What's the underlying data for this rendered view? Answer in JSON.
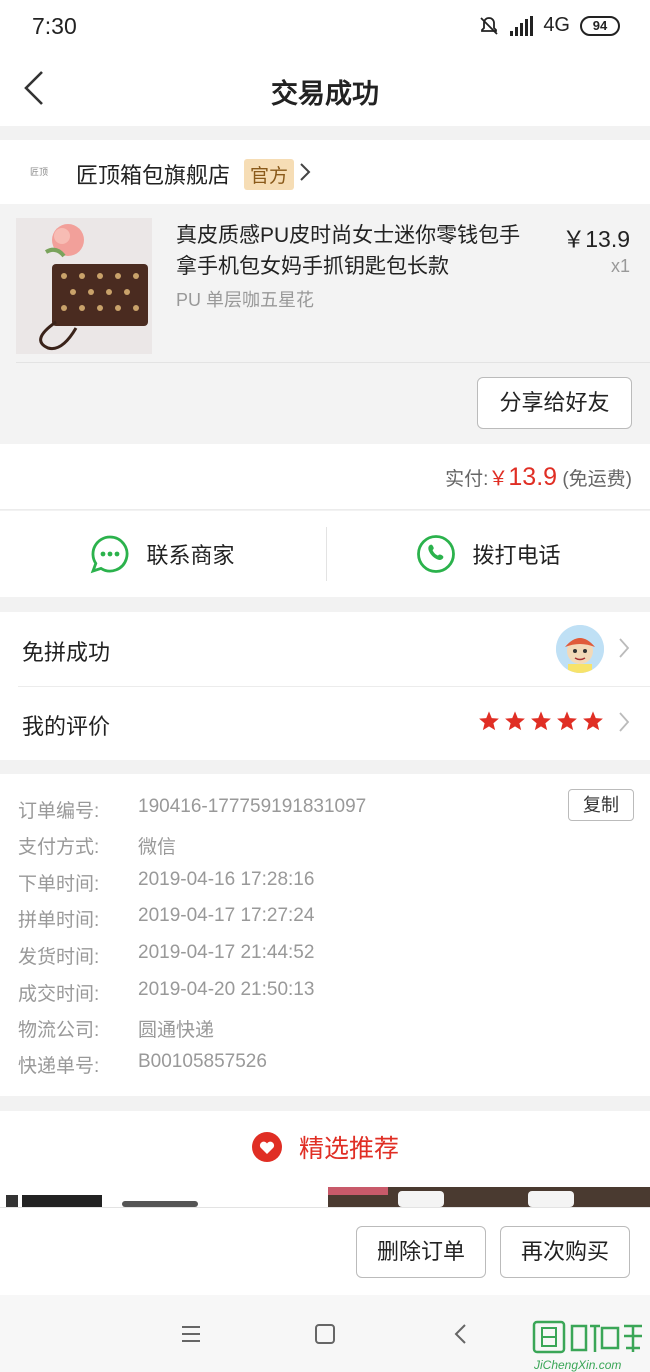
{
  "status_bar": {
    "time": "7:30",
    "network": "4G",
    "battery": "94"
  },
  "nav": {
    "title": "交易成功"
  },
  "shop": {
    "logo_text": "匠顶",
    "name": "匠顶箱包旗舰店",
    "badge": "官方"
  },
  "product": {
    "title": "真皮质感PU皮时尚女士迷你零钱包手拿手机包女妈手抓钥匙包长款",
    "spec": "PU 单层咖五星花",
    "price": "￥13.9",
    "qty": "x1",
    "share_label": "分享给好友"
  },
  "payment": {
    "label": "实付:",
    "currency": "￥",
    "amount": "13.9",
    "note": "(免运费)"
  },
  "contact": {
    "merchant_label": "联系商家",
    "call_label": "拨打电话"
  },
  "rows": {
    "group_label": "免拼成功",
    "review_label": "我的评价",
    "review_stars": 5
  },
  "order_info": {
    "copy_label": "复制",
    "lines": [
      {
        "k": "订单编号:",
        "v": "190416-177759191831097"
      },
      {
        "k": "支付方式:",
        "v": "微信"
      },
      {
        "k": "下单时间:",
        "v": "2019-04-16 17:28:16"
      },
      {
        "k": "拼单时间:",
        "v": "2019-04-17 17:27:24"
      },
      {
        "k": "发货时间:",
        "v": "2019-04-17 21:44:52"
      },
      {
        "k": "成交时间:",
        "v": "2019-04-20 21:50:13"
      },
      {
        "k": "物流公司:",
        "v": "圆通快递"
      },
      {
        "k": "快递单号:",
        "v": "B00105857526"
      }
    ]
  },
  "recommend": {
    "title": "精选推荐"
  },
  "bottom": {
    "delete_label": "删除订单",
    "rebuy_label": "再次购买"
  },
  "watermark": {
    "text": "集诚信",
    "url": "JiChengXin.com"
  },
  "colors": {
    "accent_red": "#e02e24",
    "green": "#2bb24c",
    "badge_bg": "#f6ddb5"
  }
}
